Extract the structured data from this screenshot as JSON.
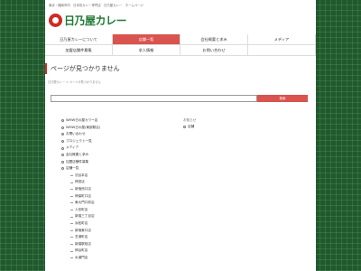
{
  "header": {
    "top_note": "東京・福岡市内　日本初カレー専門店　日乃屋カレー　ホームページ",
    "logo_text": "日乃屋カレー"
  },
  "nav": {
    "row1": [
      "日乃屋カレーについて",
      "店舗一覧",
      "会社概要と求み",
      "メディア"
    ],
    "row2": [
      "加盟店舗件募集",
      "求人情報",
      "お問い合わせ",
      ""
    ],
    "active_label": "店舗一覧"
  },
  "page": {
    "title": "ページが見つかりません",
    "breadcrumb": "日乃屋カレー > ページが見つかりません"
  },
  "search": {
    "value": "",
    "placeholder": "",
    "button_label": "検索"
  },
  "list": {
    "items": [
      {
        "label": "WMW日の屋カワー店",
        "sub": false
      },
      {
        "label": "WMW日の屋(東部駅店)",
        "sub": false
      },
      {
        "label": "お問い合わせ",
        "sub": false
      },
      {
        "label": "プロジェクト一覧",
        "sub": false
      },
      {
        "label": "メディア",
        "sub": false
      },
      {
        "label": "会社概要と求み",
        "sub": false
      },
      {
        "label": "加盟店舗件募集",
        "sub": false
      },
      {
        "label": "店舗一覧",
        "sub": false
      },
      {
        "label": "渋谷本店",
        "sub": true
      },
      {
        "label": "神田店",
        "sub": true
      },
      {
        "label": "新宿西口店",
        "sub": true
      },
      {
        "label": "神保町口店",
        "sub": true
      },
      {
        "label": "東大門口前店",
        "sub": true
      },
      {
        "label": "人形町店",
        "sub": true
      },
      {
        "label": "新橋三丁目店",
        "sub": true
      },
      {
        "label": "浜松町店",
        "sub": true
      },
      {
        "label": "新宿東口店",
        "sub": true
      },
      {
        "label": "芝浦町店",
        "sub": true
      },
      {
        "label": "新橋駅前店",
        "sub": true
      },
      {
        "label": "神谷町店",
        "sub": true
      },
      {
        "label": "水道門店",
        "sub": true
      }
    ]
  },
  "news": {
    "heading": "お知らせ",
    "items": [
      "店舗"
    ]
  },
  "colors": {
    "accent_red": "#d9534f",
    "brand_green": "#1f7a34",
    "background_green": "#1f5a2c"
  }
}
